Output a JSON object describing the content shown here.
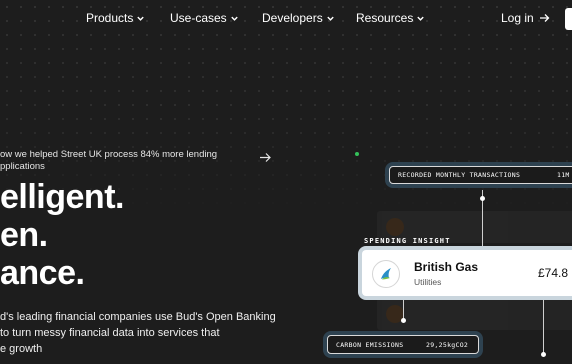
{
  "nav": {
    "items": [
      {
        "label": "Products"
      },
      {
        "label": "Use-cases"
      },
      {
        "label": "Developers"
      },
      {
        "label": "Resources"
      }
    ],
    "login_label": "Log in"
  },
  "hero": {
    "announcement": [
      "ow we helped Street UK process 84% more lending",
      "pplications"
    ],
    "headline": [
      "elligent.",
      "en.",
      "ance."
    ],
    "description": [
      "d's leading financial companies use Bud's Open Banking",
      "to turn messy financial data into services that",
      "e growth"
    ]
  },
  "cards": {
    "transactions": {
      "label": "RECORDED MONTHLY TRANSACTIONS",
      "value": "11M"
    },
    "spending_insight": "SPENDING INSIGHT",
    "merchant": {
      "name": "British Gas",
      "category": "Utilities",
      "amount": "£74.8"
    },
    "carbon": {
      "label": "CARBON EMISSIONS",
      "value": "29,25kgCO2"
    }
  }
}
